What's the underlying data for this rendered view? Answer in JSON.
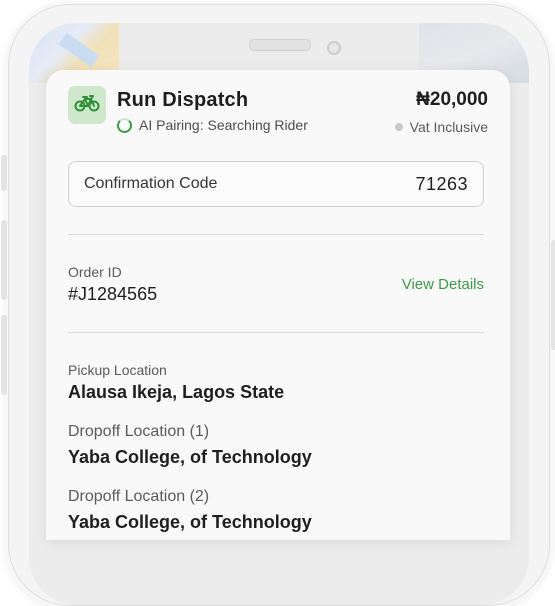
{
  "order": {
    "title": "Run Dispatch",
    "status": "AI Pairing: Searching Rider",
    "price": "₦20,000",
    "vat_note": "Vat Inclusive",
    "vehicle_icon": "bicycle-icon"
  },
  "confirmation": {
    "label": "Confirmation Code",
    "code": "71263"
  },
  "order_id": {
    "label": "Order ID",
    "value": "#J1284565",
    "action": "View Details"
  },
  "locations": [
    {
      "label": "Pickup Location",
      "value": "Alausa Ikeja, Lagos State"
    },
    {
      "label": "Dropoff Location (1)",
      "value": "Yaba College, of Technology"
    },
    {
      "label": "Dropoff Location (2)",
      "value": "Yaba College, of Technology"
    }
  ],
  "colors": {
    "accent": "#3d9a44",
    "icon_bg": "#cfe8cb"
  }
}
